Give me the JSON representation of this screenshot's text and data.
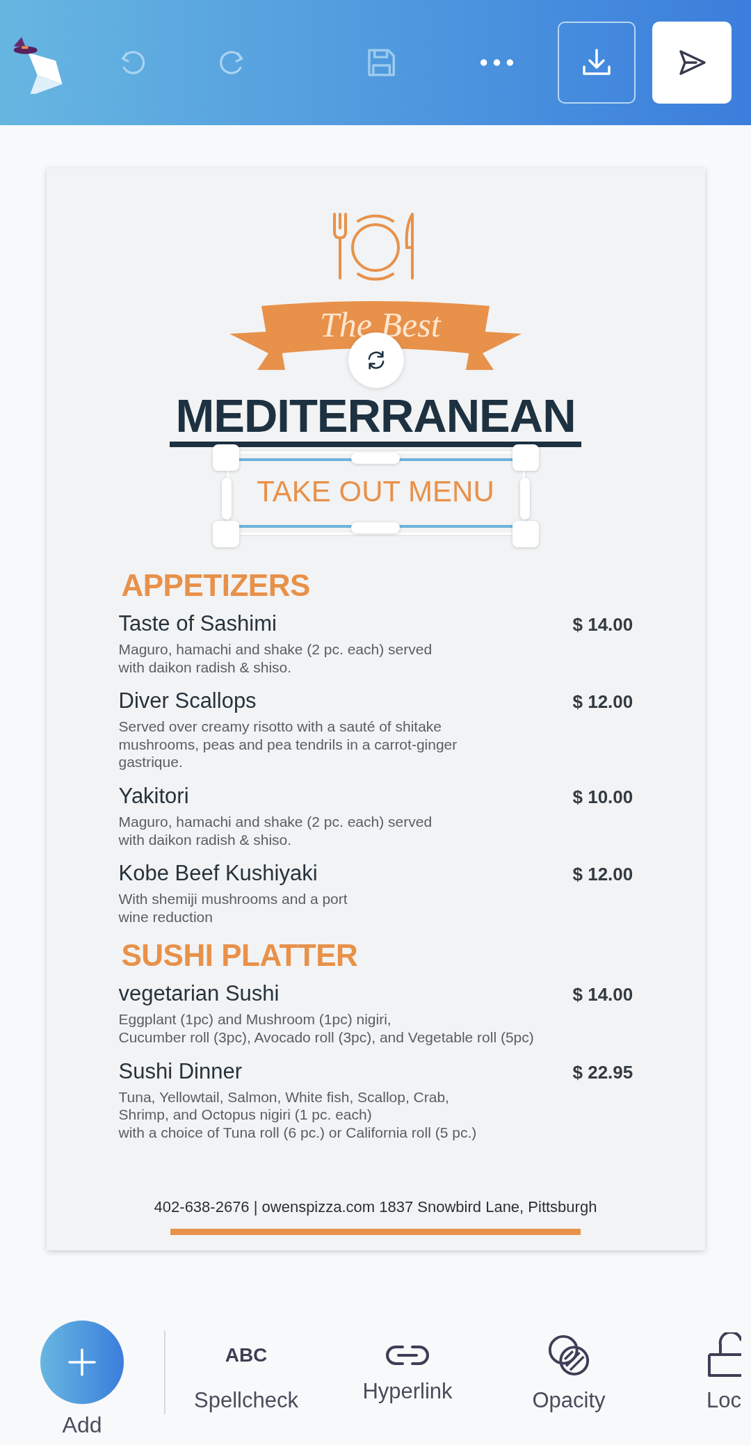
{
  "menu": {
    "banner_text": "The Best",
    "title": "MEDITERRANEAN",
    "subtitle": "TAKE OUT MENU",
    "sections": [
      {
        "heading": "APPETIZERS",
        "items": [
          {
            "name": "Taste of Sashimi",
            "price": "$ 14.00",
            "description": [
              "Maguro, hamachi and shake (2 pc. each) served",
              "with daikon radish & shiso."
            ]
          },
          {
            "name": "Diver Scallops",
            "price": "$ 12.00",
            "description": [
              "Served over creamy risotto with a sauté of shitake",
              "mushrooms,  peas and pea tendrils in a carrot-ginger",
              "gastrique."
            ]
          },
          {
            "name": "Yakitori",
            "price": "$ 10.00",
            "description": [
              "Maguro, hamachi and shake (2 pc. each) served",
              "with daikon radish & shiso."
            ]
          },
          {
            "name": "Kobe Beef Kushiyaki",
            "price": "$ 12.00",
            "description": [
              "With shemiji mushrooms and a port",
              "wine reduction"
            ]
          }
        ]
      },
      {
        "heading": "SUSHI PLATTER",
        "items": [
          {
            "name": "vegetarian Sushi",
            "price": "$ 14.00",
            "description": [
              "Eggplant (1pc) and Mushroom (1pc) nigiri,",
              "Cucumber roll (3pc), Avocado roll (3pc), and Vegetable roll (5pc)"
            ]
          },
          {
            "name": "Sushi Dinner",
            "price": "$ 22.95",
            "description": [
              "Tuna, Yellowtail, Salmon, White fish, Scallop, Crab,",
              "Shrimp, and Octopus nigiri (1 pc. each)",
              "with a choice of Tuna roll (6 pc.) or California roll (5 pc.)"
            ]
          }
        ]
      }
    ],
    "footer": "402-638-2676 | owenspizza.com 1837 Snowbird Lane, Pittsburgh"
  },
  "add_button": {
    "label": "Add"
  },
  "tools": [
    {
      "kind": "spellcheck",
      "label": "Spellcheck",
      "icon_text": "ABC"
    },
    {
      "kind": "link",
      "label": "Hyperlink"
    },
    {
      "kind": "opacity",
      "label": "Opacity"
    },
    {
      "kind": "lock",
      "label": "Loc"
    }
  ]
}
